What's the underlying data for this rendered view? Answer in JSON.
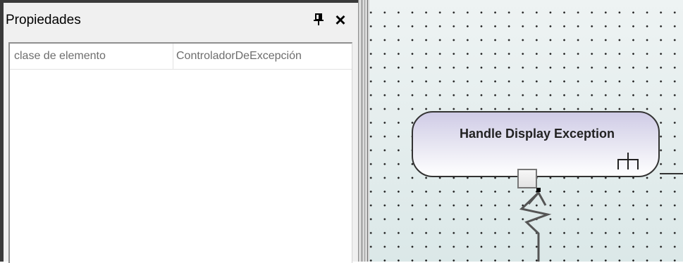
{
  "properties_panel": {
    "title": "Propiedades",
    "pin_icon": "pin-icon",
    "close_icon": "close-icon",
    "close_glyph": "×",
    "rows": [
      {
        "key": "clase de elemento",
        "value": "ControladorDeExcepción"
      }
    ]
  },
  "diagram": {
    "action_node": {
      "label": "Handle Display Exception",
      "icon": "call-behavior-rake-icon"
    },
    "exception_pin": {
      "icon": "exception-pin"
    },
    "exception_flow": {
      "icon": "lightning-arrow"
    },
    "colors": {
      "node_gradient_top": "#cfcbe6",
      "node_gradient_bottom": "#ffffff",
      "canvas_background": "#e3ecec"
    }
  }
}
